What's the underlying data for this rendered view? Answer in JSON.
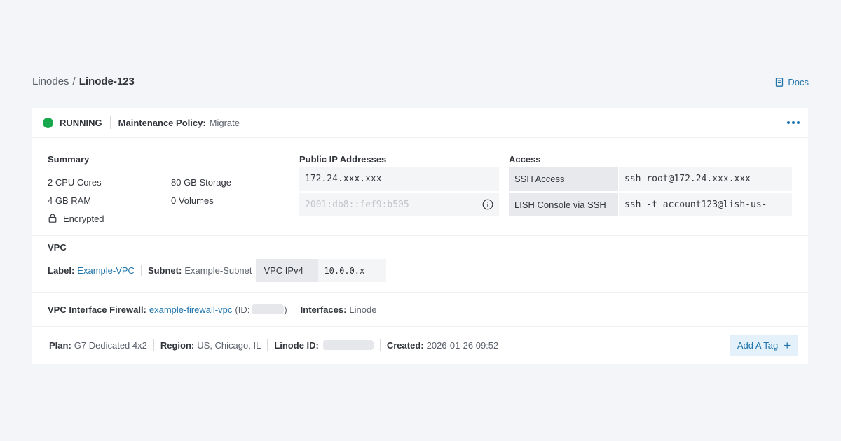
{
  "breadcrumb": {
    "parent": "Linodes",
    "separator": "/",
    "current": "Linode-123"
  },
  "docs": {
    "label": "Docs",
    "icon": "book-icon"
  },
  "status": {
    "label": "RUNNING",
    "color": "#17a74c",
    "maintenance_label": "Maintenance Policy:",
    "maintenance_value": "Migrate"
  },
  "summary": {
    "title": "Summary",
    "cpu": "2 CPU Cores",
    "ram": "4 GB RAM",
    "storage": "80 GB Storage",
    "volumes": "0 Volumes",
    "encrypted": "Encrypted"
  },
  "public_ip": {
    "title": "Public IP Addresses",
    "ipv4": "172.24.xxx.xxx",
    "ipv6": "2001:db8::fef9:b505"
  },
  "access": {
    "title": "Access",
    "rows": [
      {
        "label": "SSH Access",
        "value": "ssh root@172.24.xxx.xxx"
      },
      {
        "label": "LISH Console via SSH",
        "value": "ssh -t account123@lish-us-"
      }
    ]
  },
  "vpc": {
    "title": "VPC",
    "label_key": "Label:",
    "label_value": "Example-VPC",
    "subnet_key": "Subnet:",
    "subnet_value": "Example-Subnet",
    "ipv4_key": "VPC IPv4",
    "ipv4_value": "10.0.0.x"
  },
  "firewall": {
    "key": "VPC Interface Firewall:",
    "value": "example-firewall-vpc",
    "id_prefix": "(ID:",
    "id_suffix": ")",
    "interfaces_key": "Interfaces:",
    "interfaces_value": "Linode"
  },
  "footer": {
    "plan_key": "Plan:",
    "plan_value": "G7 Dedicated 4x2",
    "region_key": "Region:",
    "region_value": "US, Chicago, IL",
    "linode_id_key": "Linode ID:",
    "created_key": "Created:",
    "created_value": "2026-01-26 09:52",
    "add_tag": "Add A Tag",
    "add_tag_icon": "+"
  },
  "colors": {
    "accent": "#1f74ac",
    "running": "#17a74c",
    "background": "#f4f5f8"
  }
}
